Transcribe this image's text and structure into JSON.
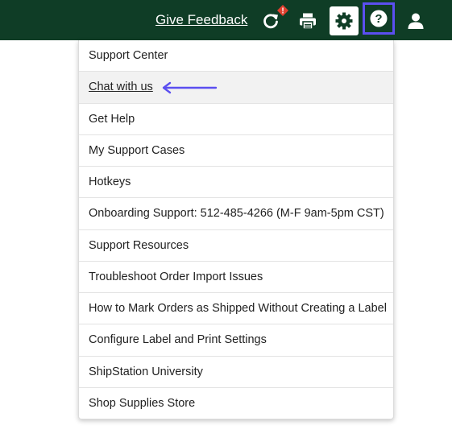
{
  "topbar": {
    "feedback_label": "Give Feedback",
    "icons": [
      "refresh-icon",
      "print-icon",
      "gear-icon",
      "help-icon",
      "user-icon"
    ],
    "alert_badge_text": "!",
    "colors": {
      "background": "#0f3d26",
      "alert": "#e0402f",
      "highlight_outline": "#5b4ff0"
    }
  },
  "help_menu": {
    "items": [
      {
        "label": "Support Center"
      },
      {
        "label": "Chat with us"
      },
      {
        "label": "Get Help"
      },
      {
        "label": "My Support Cases"
      },
      {
        "label": "Hotkeys"
      },
      {
        "label": "Onboarding Support: 512-485-4266 (M-F 9am-5pm CST)"
      },
      {
        "label": "Support Resources"
      },
      {
        "label": "Troubleshoot Order Import Issues"
      },
      {
        "label": "How to Mark Orders as Shipped Without Creating a Label"
      },
      {
        "label": "Configure Label and Print Settings"
      },
      {
        "label": "ShipStation University"
      },
      {
        "label": "Shop Supplies Store"
      }
    ],
    "annotation_color": "#5b4ff0"
  }
}
